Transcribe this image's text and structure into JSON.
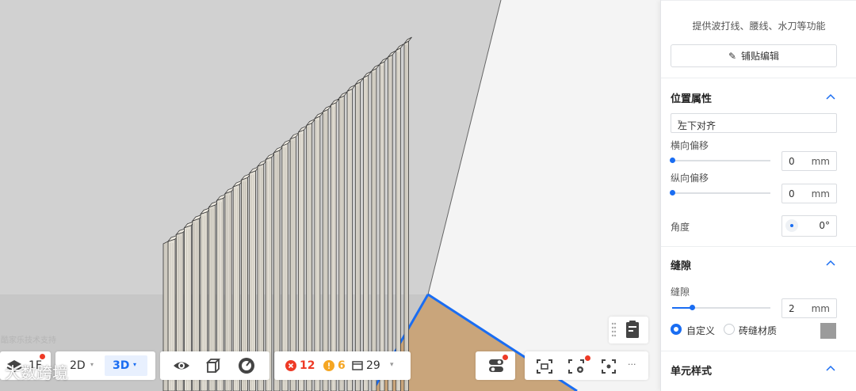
{
  "panel": {
    "description": "提供波打线、腰线、水刀等功能",
    "edit_button": "铺贴编辑",
    "position_section": {
      "title": "位置属性",
      "align_value": "左下对齐",
      "h_offset_label": "横向偏移",
      "h_offset_value": "0",
      "v_offset_label": "纵向偏移",
      "v_offset_value": "0",
      "unit": "mm",
      "angle_label": "角度",
      "angle_value": "0°",
      "h_offset_level": 0,
      "v_offset_level": 0
    },
    "gap_section": {
      "title": "缝隙",
      "gap_label": "缝隙",
      "gap_value": "2",
      "unit": "mm",
      "gap_level": 0.2,
      "radio_custom": "自定义",
      "radio_material": "砖缝材质",
      "selected": "自定义",
      "gap_color": "#9b9b9b"
    },
    "unit_section": {
      "title": "单元样式"
    }
  },
  "toolbar": {
    "floor": "1F",
    "view_2d": "2D",
    "view_3d": "3D",
    "errors": "12",
    "warnings": "6",
    "items": "29",
    "more": "···"
  },
  "watermark": {
    "support": "酷家乐技术支持",
    "brand": "大数跨境"
  },
  "colors": {
    "accent": "#1a6df2",
    "error": "#ee3a26",
    "warning": "#f5a623"
  }
}
